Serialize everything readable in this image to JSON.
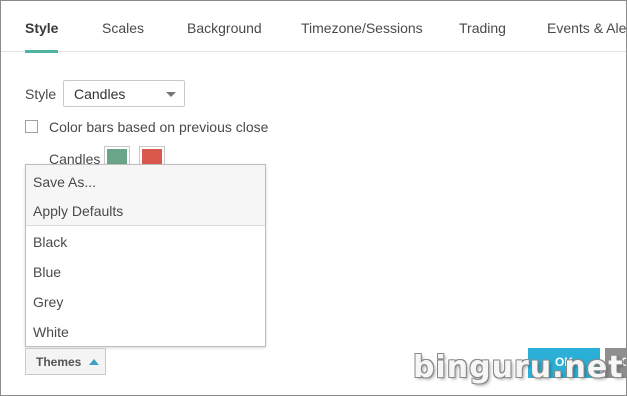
{
  "tabs": [
    {
      "label": "Style",
      "active": true
    },
    {
      "label": "Scales",
      "active": false
    },
    {
      "label": "Background",
      "active": false
    },
    {
      "label": "Timezone/Sessions",
      "active": false
    },
    {
      "label": "Trading",
      "active": false
    },
    {
      "label": "Events & Alerts",
      "active": false
    }
  ],
  "style_row": {
    "label": "Style",
    "selected": "Candles"
  },
  "color_bars": {
    "label": "Color bars based on previous close",
    "checked": false
  },
  "candles_row": {
    "label": "Candles",
    "up_color": "#6aa588",
    "down_color": "#d9584b"
  },
  "themes_menu": {
    "actions": [
      "Save As...",
      "Apply Defaults"
    ],
    "themes": [
      "Black",
      "Blue",
      "Grey",
      "White"
    ]
  },
  "themes_button": {
    "label": "Themes"
  },
  "footer": {
    "ok_label": "OK",
    "cancel_label": "C"
  },
  "watermark": "binguru.net",
  "accent_color": "#4fb3a0",
  "ok_color": "#2ab0d6"
}
